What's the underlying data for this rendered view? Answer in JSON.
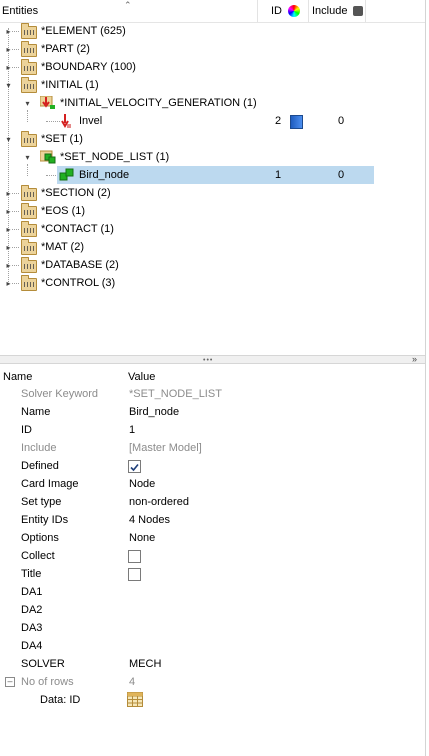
{
  "header": {
    "entities_label": "Entities",
    "id_label": "ID",
    "include_label": "Include",
    "sort_icon": "chevron-up-icon"
  },
  "tree": {
    "element": "*ELEMENT  (625)",
    "part": "*PART  (2)",
    "boundary": "*BOUNDARY  (100)",
    "initial": "*INITIAL  (1)",
    "ivg": "*INITIAL_VELOCITY_GENERATION  (1)",
    "invel": {
      "label": "Invel",
      "id": "2",
      "include": "0"
    },
    "set": "*SET  (1)",
    "set_node_list": "*SET_NODE_LIST  (1)",
    "bird_node": {
      "label": "Bird_node",
      "id": "1",
      "include": "0"
    },
    "section": "*SECTION  (2)",
    "eos": "*EOS  (1)",
    "contact": "*CONTACT  (1)",
    "mat": "*MAT  (2)",
    "database": "*DATABASE  (2)",
    "control": "*CONTROL  (3)"
  },
  "props": {
    "name_header": "Name",
    "value_header": "Value",
    "solver_keyword": {
      "name": "Solver Keyword",
      "value": "*SET_NODE_LIST"
    },
    "name": {
      "name": "Name",
      "value": "Bird_node"
    },
    "id": {
      "name": "ID",
      "value": "1"
    },
    "include": {
      "name": "Include",
      "value": "[Master Model]"
    },
    "defined": {
      "name": "Defined",
      "checked": true
    },
    "card_image": {
      "name": "Card Image",
      "value": "Node"
    },
    "set_type": {
      "name": "Set type",
      "value": "non-ordered"
    },
    "entity_ids": {
      "name": "Entity IDs",
      "value": "4 Nodes"
    },
    "options": {
      "name": "Options",
      "value": "None"
    },
    "collect": {
      "name": "Collect",
      "checked": false
    },
    "title": {
      "name": "Title",
      "checked": false
    },
    "da1": {
      "name": "DA1"
    },
    "da2": {
      "name": "DA2"
    },
    "da3": {
      "name": "DA3"
    },
    "da4": {
      "name": "DA4"
    },
    "solver": {
      "name": "SOLVER",
      "value": "MECH"
    },
    "no_of_rows": {
      "name": "No of rows",
      "value": "4"
    },
    "data_id": {
      "name": "Data: ID"
    }
  },
  "colors": {
    "selection": "#bcd9ef",
    "folder": "#ecd39a",
    "set_green": "#22b022",
    "id_blue": "#2f6fd0"
  }
}
